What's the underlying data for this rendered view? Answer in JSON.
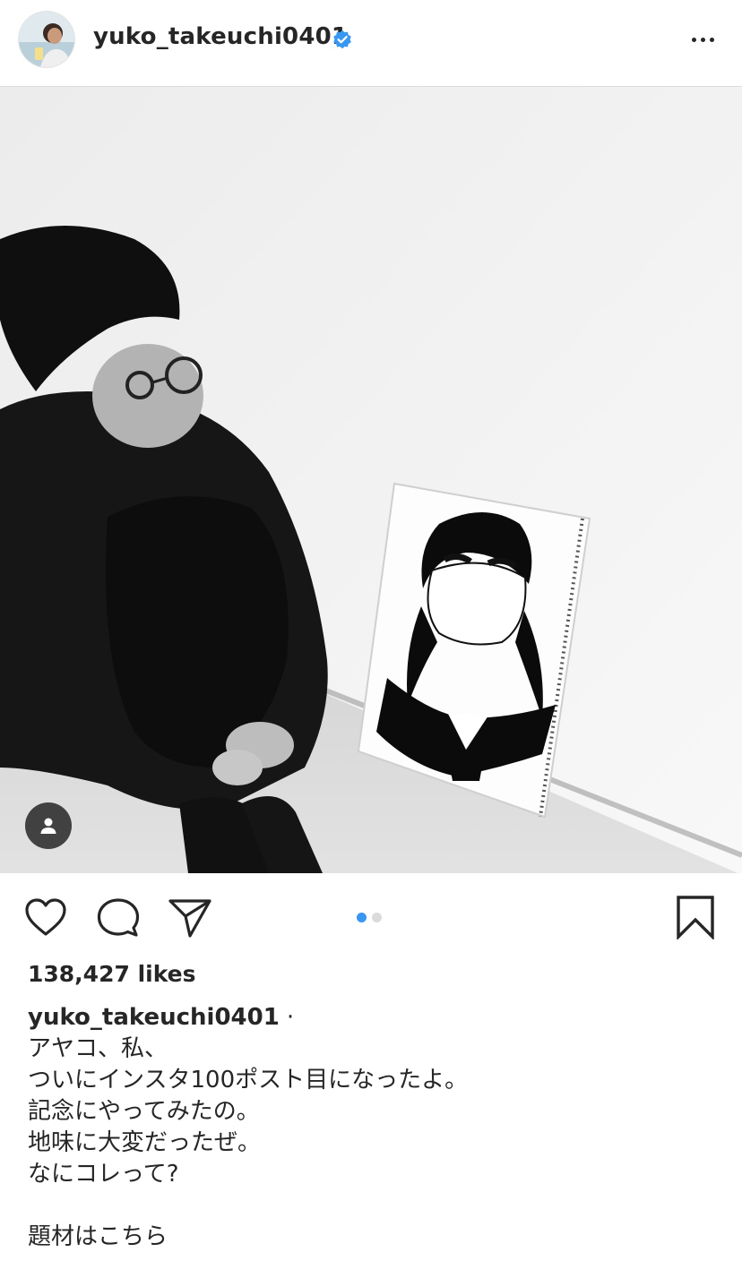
{
  "header": {
    "username": "yuko_takeuchi0401",
    "verified_icon": "verified-badge-icon",
    "more_icon": "more-horizontal-icon"
  },
  "post": {
    "image_description_icon": "photo",
    "tag_icon": "user-tag-icon"
  },
  "actions": {
    "like_icon": "heart-outline-icon",
    "comment_icon": "comment-bubble-icon",
    "share_icon": "paper-plane-icon",
    "save_icon": "bookmark-outline-icon",
    "carousel_dots": 2,
    "active_dot": 0,
    "active_dot_color": "#3897f0",
    "inactive_dot_color": "#dbdbdb"
  },
  "likes": "138,427 likes",
  "caption": {
    "username": "yuko_takeuchi0401",
    "separator": "·",
    "lines": [
      "アヤコ、私、",
      "ついにインスタ100ポスト目になったよ。",
      "記念にやってみたの。",
      "地味に大変だったぜ。",
      "なにコレって?",
      "",
      "題材はこちら"
    ]
  },
  "colors": {
    "text": "#262626",
    "verified": "#3897f0",
    "divider": "#dbdbdb"
  }
}
